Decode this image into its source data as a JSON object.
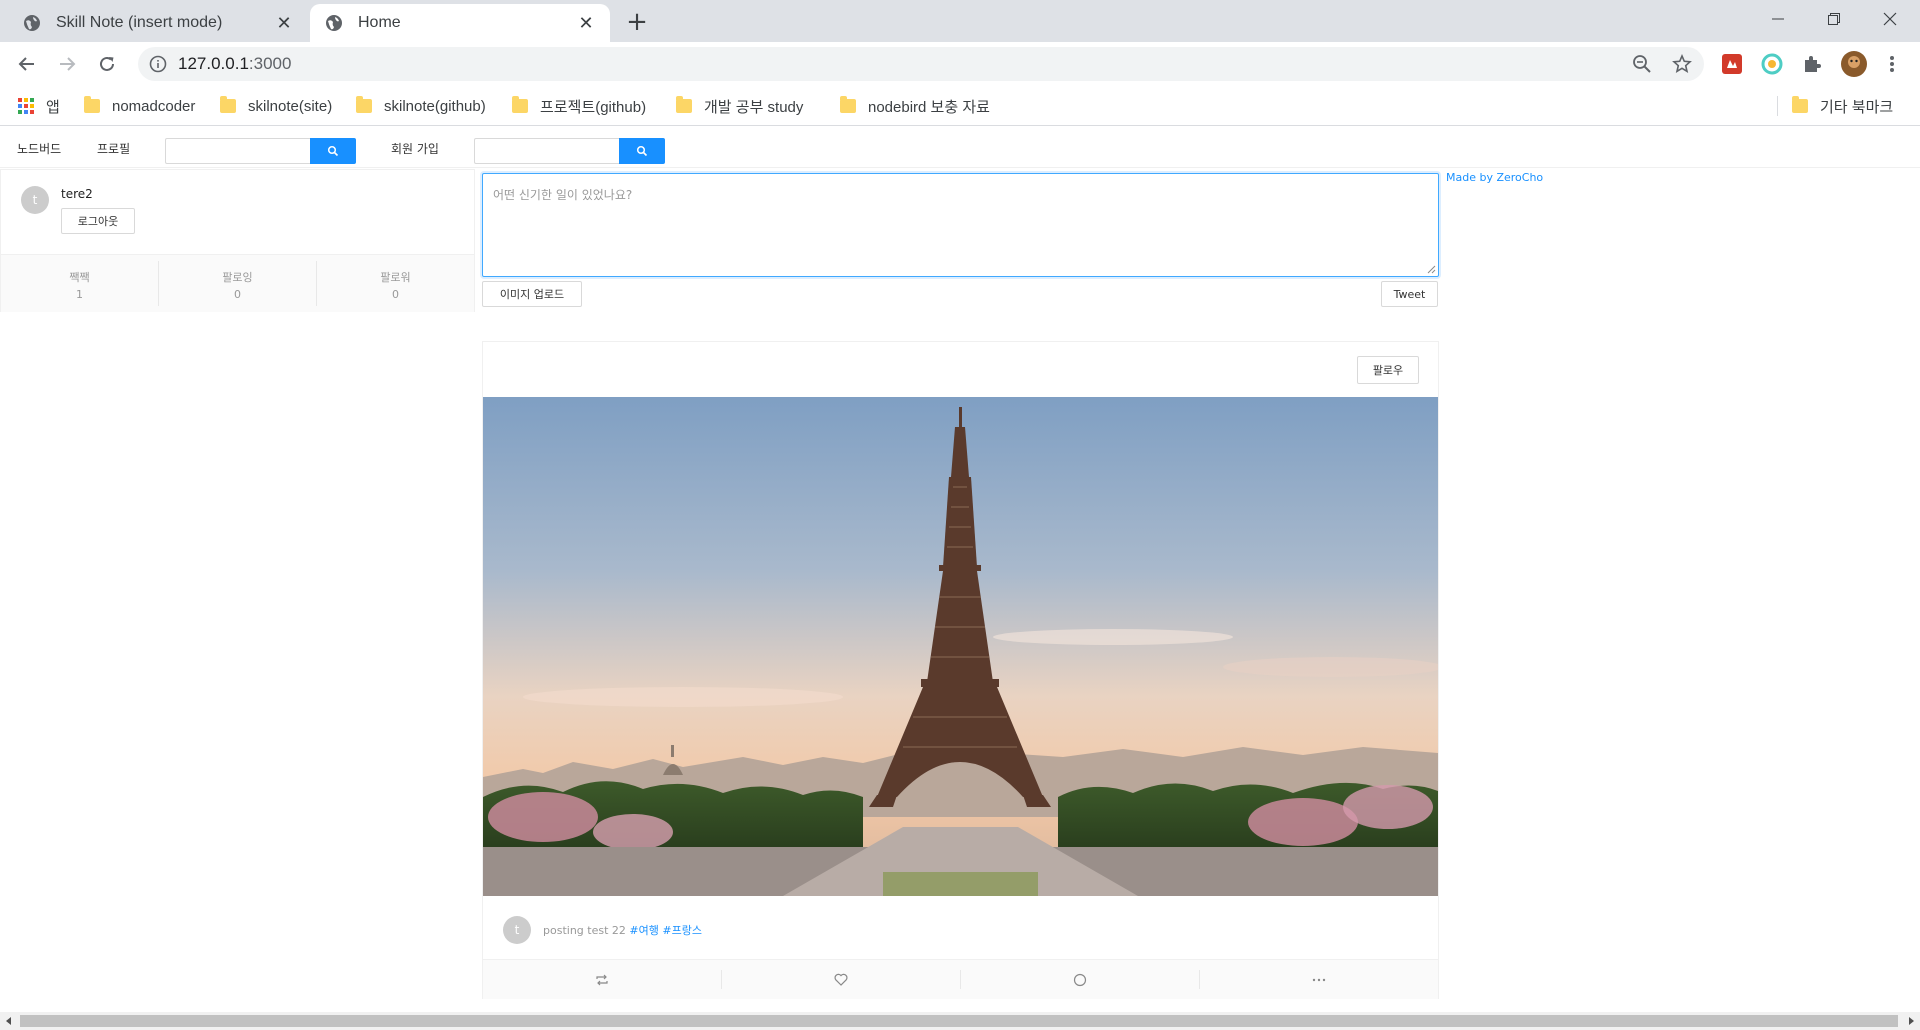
{
  "browser": {
    "tabs": [
      {
        "title": "Skill Note (insert mode)",
        "active": false
      },
      {
        "title": "Home",
        "active": true
      }
    ],
    "url": {
      "host": "127.0.0.1",
      "port": ":3000"
    },
    "bookmarks": [
      {
        "label": "앱",
        "icon": "apps-grid-icon"
      },
      {
        "label": "nomadcoder",
        "icon": "folder-icon"
      },
      {
        "label": "skilnote(site)",
        "icon": "folder-icon"
      },
      {
        "label": "skilnote(github)",
        "icon": "folder-icon"
      },
      {
        "label": "프로젝트(github)",
        "icon": "folder-icon"
      },
      {
        "label": "개발 공부 study",
        "icon": "folder-icon"
      },
      {
        "label": "nodebird 보충 자료",
        "icon": "folder-icon"
      }
    ],
    "other_bookmarks": "기타 북마크"
  },
  "menu": {
    "items": [
      "노드버드",
      "프로필",
      "회원 가입"
    ],
    "accent": "#1890ff"
  },
  "profile": {
    "avatar_letter": "t",
    "nickname": "tere2",
    "logout_label": "로그아웃",
    "stats": [
      {
        "label": "짹짹",
        "value": "1"
      },
      {
        "label": "팔로잉",
        "value": "0"
      },
      {
        "label": "팔로워",
        "value": "0"
      }
    ]
  },
  "composer": {
    "placeholder": "어떤 신기한 일이 있었나요?",
    "upload_label": "이미지 업로드",
    "submit_label": "Tweet"
  },
  "credit": "Made by ZeroCho",
  "post": {
    "follow_label": "팔로우",
    "image": "eiffel-tower-photo",
    "avatar_letter": "t",
    "text": "posting test 22 ",
    "hashtags": [
      "#여행",
      "#프랑스"
    ],
    "actions": [
      "retweet-icon",
      "heart-icon",
      "comment-icon",
      "ellipsis-icon"
    ]
  }
}
